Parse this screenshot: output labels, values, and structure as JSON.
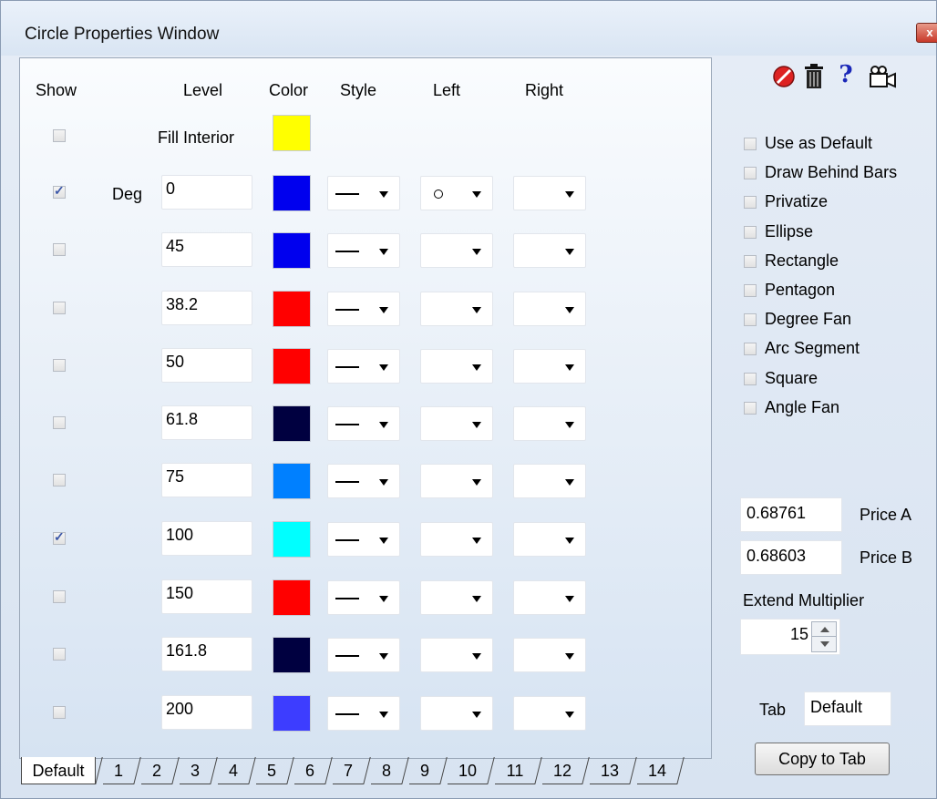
{
  "window": {
    "title": "Circle Properties Window",
    "close_glyph": "x"
  },
  "headers": {
    "show": "Show",
    "level": "Level",
    "color": "Color",
    "style": "Style",
    "left": "Left",
    "right": "Right"
  },
  "fill": {
    "label": "Fill Interior",
    "color": "#ffff00",
    "checked": false
  },
  "deg_label": "Deg",
  "rows": [
    {
      "checked": true,
      "level": "0",
      "color": "#0000ee",
      "left_circle": true
    },
    {
      "checked": false,
      "level": "45",
      "color": "#0000ee",
      "left_circle": false
    },
    {
      "checked": false,
      "level": "38.2",
      "color": "#ff0000",
      "left_circle": false
    },
    {
      "checked": false,
      "level": "50",
      "color": "#ff0000",
      "left_circle": false
    },
    {
      "checked": false,
      "level": "61.8",
      "color": "#000040",
      "left_circle": false
    },
    {
      "checked": false,
      "level": "75",
      "color": "#0080ff",
      "left_circle": false
    },
    {
      "checked": true,
      "level": "100",
      "color": "#00ffff",
      "left_circle": false
    },
    {
      "checked": false,
      "level": "150",
      "color": "#ff0000",
      "left_circle": false
    },
    {
      "checked": false,
      "level": "161.8",
      "color": "#000040",
      "left_circle": false
    },
    {
      "checked": false,
      "level": "200",
      "color": "#3d3dff",
      "left_circle": false
    }
  ],
  "options": [
    {
      "label": "Use as Default",
      "checked": false
    },
    {
      "label": "Draw Behind Bars",
      "checked": false
    },
    {
      "label": "Privatize",
      "checked": false
    },
    {
      "label": "Ellipse",
      "checked": false
    },
    {
      "label": "Rectangle",
      "checked": false
    },
    {
      "label": "Pentagon",
      "checked": false
    },
    {
      "label": "Degree Fan",
      "checked": false
    },
    {
      "label": "Arc Segment",
      "checked": false
    },
    {
      "label": "Square",
      "checked": false
    },
    {
      "label": "Angle Fan",
      "checked": false
    }
  ],
  "toolbar": {
    "icons": [
      "no-entry-icon",
      "trash-icon",
      "help-icon",
      "camera-icon"
    ],
    "help_glyph": "?"
  },
  "price_a": {
    "value": "0.68761",
    "label": "Price A"
  },
  "price_b": {
    "value": "0.68603",
    "label": "Price B"
  },
  "extend": {
    "label": "Extend Multiplier",
    "value": "15"
  },
  "tab_field": {
    "label": "Tab",
    "value": "Default"
  },
  "copy_button": "Copy to Tab",
  "tabs": [
    "Default",
    "1",
    "2",
    "3",
    "4",
    "5",
    "6",
    "7",
    "8",
    "9",
    "10",
    "11",
    "12",
    "13",
    "14"
  ],
  "active_tab": "Default"
}
